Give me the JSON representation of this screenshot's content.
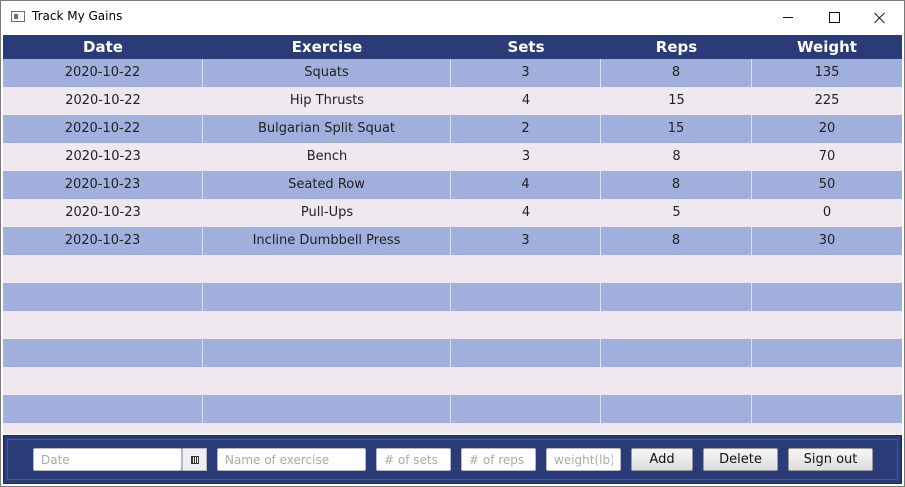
{
  "window": {
    "title": "Track My Gains"
  },
  "table": {
    "columns": [
      "Date",
      "Exercise",
      "Sets",
      "Reps",
      "Weight"
    ],
    "rows": [
      [
        "2020-10-22",
        "Squats",
        "3",
        "8",
        "135"
      ],
      [
        "2020-10-22",
        "Hip Thrusts",
        "4",
        "15",
        "225"
      ],
      [
        "2020-10-22",
        "Bulgarian Split Squat",
        "2",
        "15",
        "20"
      ],
      [
        "2020-10-23",
        "Bench",
        "3",
        "8",
        "70"
      ],
      [
        "2020-10-23",
        "Seated Row",
        "4",
        "8",
        "50"
      ],
      [
        "2020-10-23",
        "Pull-Ups",
        "4",
        "5",
        "0"
      ],
      [
        "2020-10-23",
        "Incline Dumbbell Press",
        "3",
        "8",
        "30"
      ]
    ],
    "header_color": "#2b3b78",
    "odd_row_color": "#a0afdc",
    "even_row_color": "#efe8ef"
  },
  "form": {
    "date_placeholder": "Date",
    "date_value": "",
    "exercise_placeholder": "Name of exercise",
    "exercise_value": "",
    "sets_placeholder": "# of sets",
    "sets_value": "",
    "reps_placeholder": "# of reps",
    "reps_value": "",
    "weight_placeholder": "weight(lb)",
    "weight_value": "",
    "calendar_icon": "calendar-icon",
    "add_label": "Add",
    "delete_label": "Delete",
    "signout_label": "Sign out"
  }
}
